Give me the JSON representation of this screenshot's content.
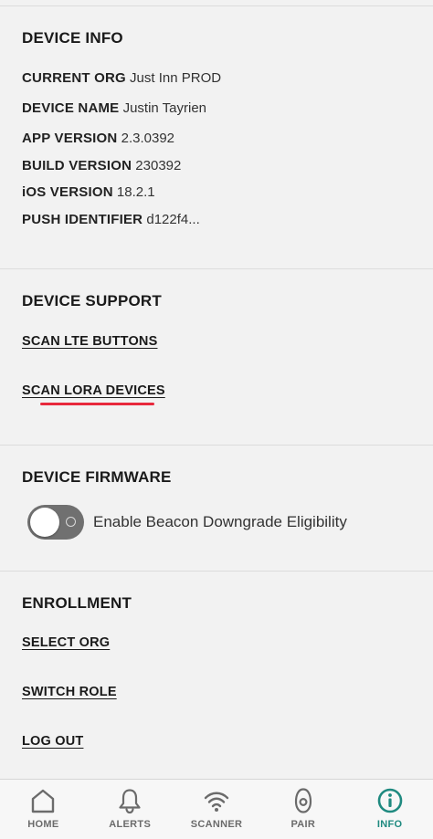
{
  "device_info": {
    "heading": "DEVICE INFO",
    "rows": [
      {
        "key": "CURRENT ORG",
        "value": "Just Inn PROD"
      },
      {
        "key": "DEVICE NAME",
        "value": "Justin Tayrien"
      },
      {
        "key": "APP VERSION",
        "value": "2.3.0392"
      },
      {
        "key": "BUILD VERSION",
        "value": "230392"
      },
      {
        "key": "iOS VERSION",
        "value": "18.2.1"
      },
      {
        "key": "PUSH IDENTIFIER",
        "value": "d122f4..."
      }
    ]
  },
  "device_support": {
    "heading": "DEVICE SUPPORT",
    "scan_lte_label": "SCAN LTE BUTTONS",
    "scan_lora_label": "SCAN LORA DEVICES"
  },
  "device_firmware": {
    "heading": "DEVICE FIRMWARE",
    "toggle_label": "Enable Beacon Downgrade Eligibility",
    "toggle_on": false
  },
  "enrollment": {
    "heading": "ENROLLMENT",
    "select_org_label": "SELECT ORG",
    "switch_role_label": "SWITCH ROLE",
    "log_out_label": "LOG OUT"
  },
  "tabbar": {
    "tabs": [
      {
        "label": "HOME",
        "icon": "home-icon"
      },
      {
        "label": "ALERTS",
        "icon": "bell-icon"
      },
      {
        "label": "SCANNER",
        "icon": "wifi-icon"
      },
      {
        "label": "PAIR",
        "icon": "beacon-icon"
      },
      {
        "label": "INFO",
        "icon": "info-icon"
      }
    ],
    "active_index": 4,
    "active_color": "#1f8a80",
    "inactive_color": "#6b6b6b"
  },
  "colors": {
    "background": "#f2f2f2",
    "highlight_red": "#e8283c",
    "toggle_off": "#707070"
  }
}
